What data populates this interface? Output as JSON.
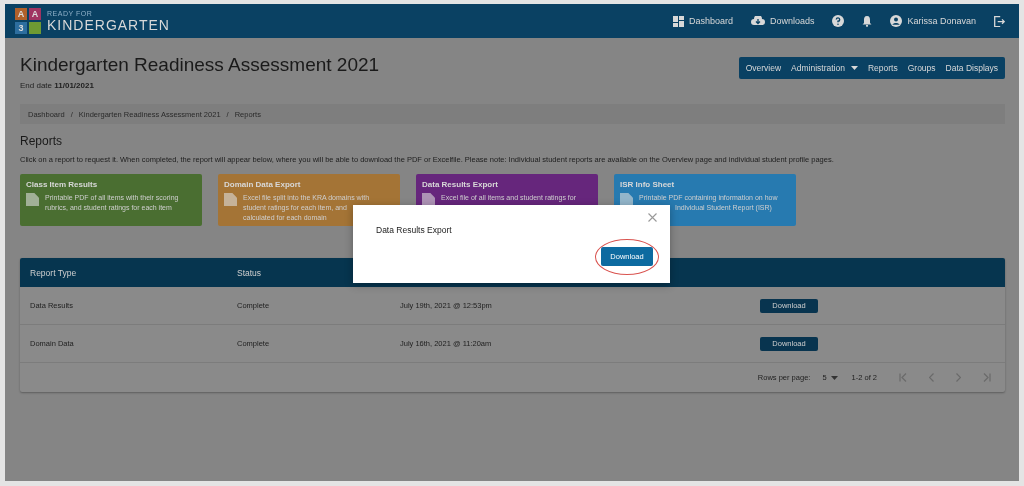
{
  "header": {
    "logo_tiles": [
      "A",
      "A",
      "3"
    ],
    "logo_top": "READY FOR",
    "logo_main": "KINDERGARTEN",
    "links": [
      {
        "kind": "dashboard",
        "label": "Dashboard"
      },
      {
        "kind": "downloads",
        "label": "Downloads"
      },
      {
        "kind": "help"
      },
      {
        "kind": "bell"
      },
      {
        "kind": "user",
        "label": "Karissa Donavan"
      },
      {
        "kind": "logout"
      }
    ]
  },
  "page": {
    "title": "Kindergarten Readiness Assessment 2021",
    "end_date_label": "End date",
    "end_date": "11/01/2021"
  },
  "nav": [
    {
      "label": "Overview",
      "dropdown": false
    },
    {
      "label": "Administration",
      "dropdown": true
    },
    {
      "label": "Reports",
      "dropdown": false
    },
    {
      "label": "Groups",
      "dropdown": false
    },
    {
      "label": "Data Displays",
      "dropdown": false
    }
  ],
  "breadcrumb": {
    "items": [
      "Dashboard",
      "Kindergarten Readiness Assessment 2021",
      "Reports"
    ],
    "separator": "/"
  },
  "reports": {
    "heading": "Reports",
    "intro": "Click on a report to request it. When completed, the report will appear below, where you will be able to download the PDF or Excelfile. Please note: Individual student reports are available on the Overview page and individual student profile pages.",
    "cards": [
      {
        "title": "Class Item Results",
        "color": "#4a6e31",
        "lines": [
          {
            "text": "Printable PDF of all items with their scoring",
            "indent": false
          },
          {
            "text": "rubrics, and student ratings for each item",
            "indent": false
          }
        ]
      },
      {
        "title": "Domain Data Export",
        "color": "#a47436",
        "lines": [
          {
            "text": "Excel file split into the KRA domains with",
            "indent": false
          },
          {
            "text": "student ratings for each item, and",
            "indent": false
          },
          {
            "text": "calculated for each domain",
            "indent": false
          }
        ]
      },
      {
        "title": "Data Results Export",
        "color": "#66267c",
        "lines": [
          {
            "text": "Excel file of all items and student ratings for",
            "indent": false
          }
        ]
      },
      {
        "title": "ISR Info Sheet",
        "color": "#277ab0",
        "lines": [
          {
            "text": "Printable PDF containing information on how",
            "indent": false
          },
          {
            "text": "Individual Student Report (ISR)",
            "indent": true
          }
        ]
      }
    ]
  },
  "table": {
    "columns": [
      "Report Type",
      "Status"
    ],
    "rows": [
      {
        "type": "Data Results",
        "status": "Complete",
        "date": "July 19th, 2021 @ 12:53pm",
        "action": "Download"
      },
      {
        "type": "Domain Data",
        "status": "Complete",
        "date": "July 16th, 2021 @ 11:20am",
        "action": "Download"
      }
    ],
    "footer": {
      "rows_label": "Rows per page:",
      "rows_value": "5",
      "range": "1-2 of 2"
    }
  },
  "modal": {
    "title": "Data Results Export",
    "button": "Download",
    "highlighted": true
  }
}
